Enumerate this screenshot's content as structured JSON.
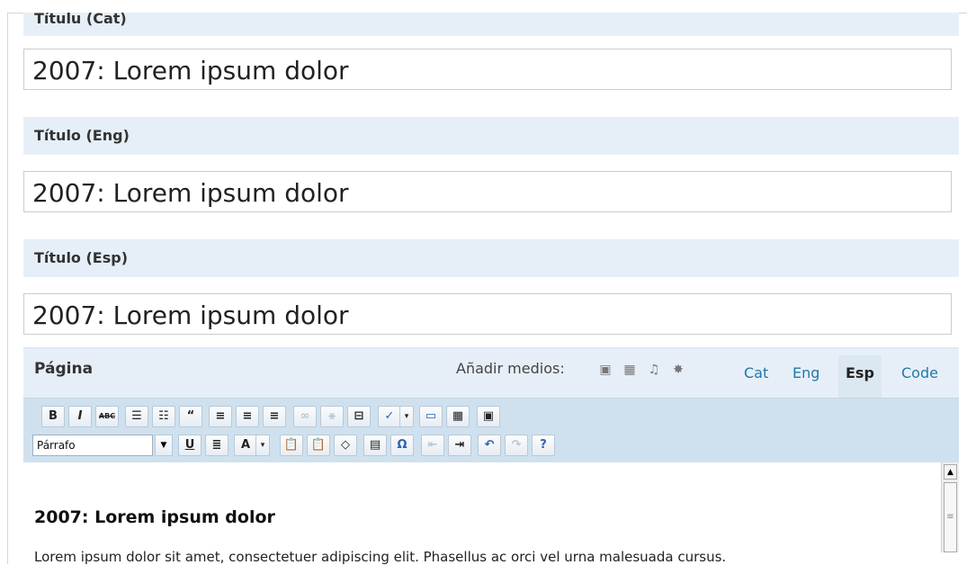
{
  "fields": [
    {
      "label": "Títulu (Cat)",
      "value": "2007: Lorem ipsum dolor"
    },
    {
      "label": "Título (Eng)",
      "value": "2007: Lorem ipsum dolor"
    },
    {
      "label": "Título (Esp)",
      "value": "2007: Lorem ipsum dolor"
    }
  ],
  "editor": {
    "label": "Página",
    "media_label": "Añadir medios:",
    "tabs": [
      "Cat",
      "Eng",
      "Esp",
      "Code"
    ],
    "active_tab": "Esp",
    "format_select": "Párrafo",
    "toolbar_row1": [
      "B",
      "I",
      "ABC",
      "☰",
      "☷",
      "“",
      "≡",
      "≡",
      "≡",
      "∞",
      "⚹",
      "⊟",
      "✓",
      "▾",
      "▭",
      "▦",
      "▣"
    ],
    "toolbar_row2": [
      "U",
      "≣",
      "A",
      "▾",
      "📋",
      "📋",
      "◇",
      "▤",
      "Ω",
      "⇤",
      "⇥",
      "↶",
      "↷",
      "?"
    ]
  },
  "content": {
    "heading": "2007: Lorem ipsum dolor",
    "paragraph": "Lorem ipsum dolor sit amet, consectetuer adipiscing elit. Phasellus ac orci vel urna malesuada cursus."
  }
}
